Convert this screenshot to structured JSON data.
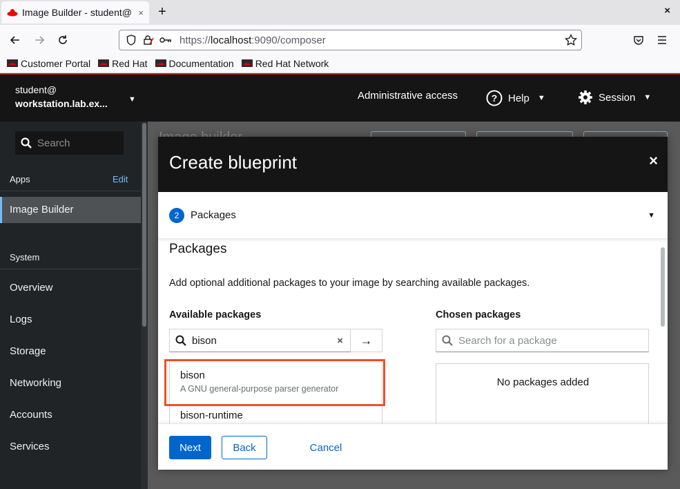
{
  "browser": {
    "tab_title": "Image Builder - student@",
    "tab_close": "×",
    "new_tab": "+",
    "window_close": "×",
    "url_scheme": "https://",
    "url_host": "localhost",
    "url_rest": ":9090/composer",
    "bookmarks": [
      "Customer Portal",
      "Red Hat",
      "Documentation",
      "Red Hat Network"
    ],
    "icons": {
      "back": "arrow-left-icon",
      "forward": "arrow-right-icon",
      "reload": "reload-icon",
      "shield": "shield-icon",
      "lock": "lock-icon",
      "key": "key-icon",
      "star": "star-icon",
      "pocket": "pocket-icon",
      "menu": "hamburger-icon"
    }
  },
  "topbar": {
    "user": "student@",
    "host": "workstation.lab.ex...",
    "admin_access": "Administrative access",
    "help": "Help",
    "session": "Session"
  },
  "sidebar": {
    "search_placeholder": "Search",
    "apps_heading": "Apps",
    "edit_link": "Edit",
    "active_item": "Image Builder",
    "system_heading": "System",
    "items": [
      "Overview",
      "Logs",
      "Storage",
      "Networking",
      "Accounts",
      "Services"
    ]
  },
  "main": {
    "ghost_title": "Image builder"
  },
  "modal": {
    "title": "Create blueprint",
    "close": "×",
    "step_number": "2",
    "step_label": "Packages",
    "section_title": "Packages",
    "description": "Add optional additional packages to your image by searching available packages.",
    "available_heading": "Available packages",
    "available_search_value": "bison",
    "clear": "×",
    "add_arrow": "→",
    "packages": [
      {
        "name": "bison",
        "summary": "A GNU general-purpose parser generator"
      },
      {
        "name": "bison-runtime",
        "summary": ""
      }
    ],
    "chosen_heading": "Chosen packages",
    "chosen_search_placeholder": "Search for a package",
    "chosen_empty": "No packages added",
    "next": "Next",
    "back": "Back",
    "cancel": "Cancel"
  },
  "colors": {
    "accent": "#0066cc",
    "highlight": "#f04e23",
    "redhat": "#ee0000"
  }
}
